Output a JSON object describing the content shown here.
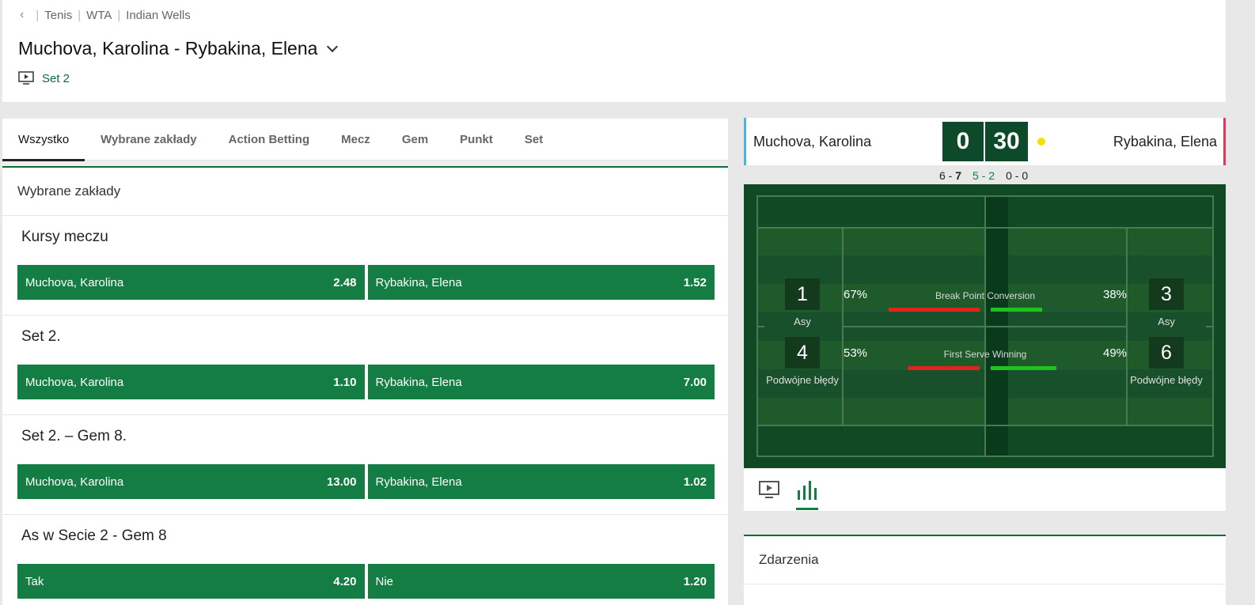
{
  "breadcrumb": {
    "items": [
      "Tenis",
      "WTA",
      "Indian Wells"
    ]
  },
  "match": {
    "title": "Muchova, Karolina - Rybakina, Elena",
    "set_label": "Set 2"
  },
  "tabs": [
    {
      "label": "Wszystko"
    },
    {
      "label": "Wybrane zakłady"
    },
    {
      "label": "Action Betting"
    },
    {
      "label": "Mecz"
    },
    {
      "label": "Gem"
    },
    {
      "label": "Punkt"
    },
    {
      "label": "Set"
    }
  ],
  "section_title": "Wybrane zakłady",
  "markets": [
    {
      "title": "Kursy meczu",
      "options": [
        {
          "name": "Muchova, Karolina",
          "price": "2.48"
        },
        {
          "name": "Rybakina, Elena",
          "price": "1.52"
        }
      ]
    },
    {
      "title": "Set 2.",
      "options": [
        {
          "name": "Muchova, Karolina",
          "price": "1.10"
        },
        {
          "name": "Rybakina, Elena",
          "price": "7.00"
        }
      ]
    },
    {
      "title": "Set 2. – Gem 8.",
      "options": [
        {
          "name": "Muchova, Karolina",
          "price": "13.00"
        },
        {
          "name": "Rybakina, Elena",
          "price": "1.02"
        }
      ]
    },
    {
      "title": "As w Secie 2 - Gem 8",
      "options": [
        {
          "name": "Tak",
          "price": "4.20"
        },
        {
          "name": "Nie",
          "price": "1.20"
        }
      ]
    }
  ],
  "scoreboard": {
    "player1": "Muchova, Karolina",
    "player2": "Rybakina, Elena",
    "points1": "0",
    "points2": "30",
    "sets": [
      {
        "p1": "6",
        "p2": "7"
      },
      {
        "p1": "5",
        "p2": "2"
      },
      {
        "p1": "0",
        "p2": "0"
      }
    ]
  },
  "stats": {
    "aces_label": "Asy",
    "df_label": "Podwójne błędy",
    "p1_aces": "1",
    "p2_aces": "3",
    "p1_df": "4",
    "p2_df": "6",
    "bp": {
      "name": "Break Point Conversion",
      "p1": "67%",
      "p2": "38%",
      "p1_frac": 0.67,
      "p2_frac": 0.38
    },
    "fs": {
      "name": "First Serve Winning",
      "p1": "53%",
      "p2": "49%",
      "p1_frac": 0.53,
      "p2_frac": 0.49
    }
  },
  "events": {
    "title": "Zdarzenia"
  },
  "colors": {
    "brand_green": "#137d43",
    "dark_green": "#0d4a2a",
    "p1_accent": "#4bb3e0",
    "p2_accent": "#e03a5b",
    "serve": "#f2e200"
  }
}
